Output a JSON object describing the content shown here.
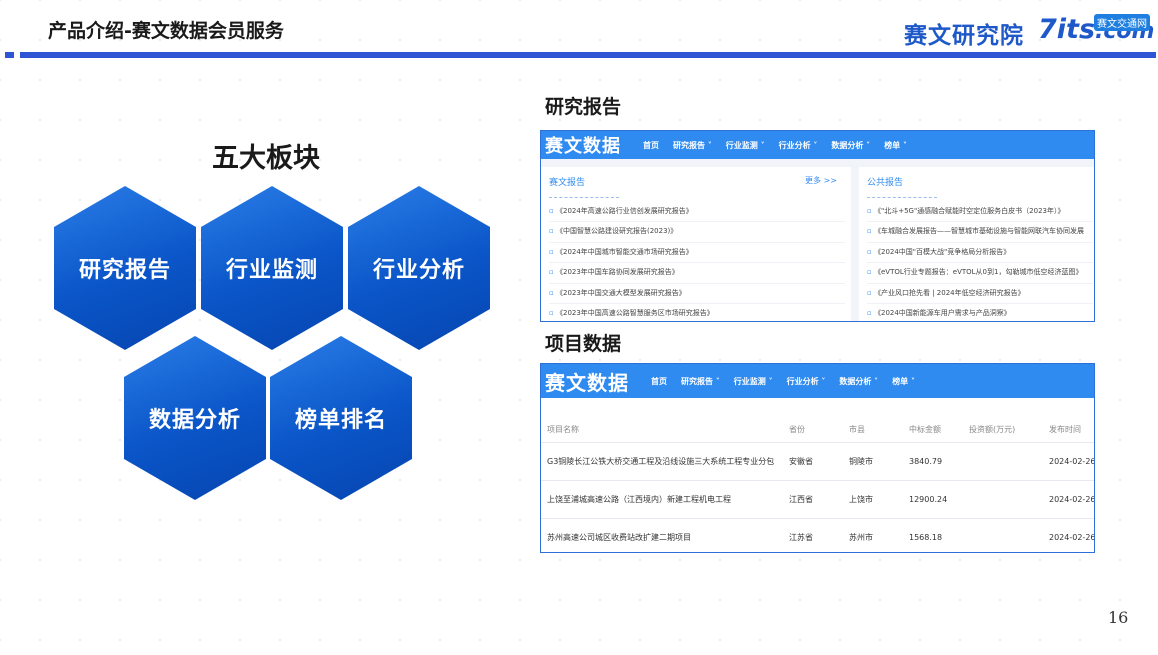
{
  "header": {
    "title": "产品介绍-赛文数据会员服务",
    "logo_text": "赛文研究院",
    "logo_7its": "7its",
    "logo_com": ".com",
    "logo_badge": "赛文交通网"
  },
  "colors": {
    "accent": "#2f54d4",
    "hex_blue": "#0a55c8",
    "nav_blue": "#2f8bf0"
  },
  "left": {
    "section_title": "五大板块",
    "modules": [
      "研究报告",
      "行业监测",
      "行业分析",
      "数据分析",
      "榜单排名"
    ]
  },
  "reports_panel": {
    "title": "研究报告",
    "nav": {
      "logo": "赛文数据",
      "items": [
        "首页",
        "研究报告 ˅",
        "行业监测 ˅",
        "行业分析 ˅",
        "数据分析 ˅",
        "榜单 ˅"
      ]
    },
    "col1": {
      "head": "赛文报告",
      "more": "更多 >>",
      "items": [
        "《2024年高速公路行业信创发展研究报告》",
        "《中国智慧公路建设研究报告(2023)》",
        "《2024年中国城市智能交通市场研究报告》",
        "《2023年中国车路协同发展研究报告》",
        "《2023年中国交通大模型发展研究报告》",
        "《2023年中国高速公路智慧服务区市场研究报告》"
      ]
    },
    "col2": {
      "head": "公共报告",
      "items": [
        "《\"北斗+5G\"通感融合赋能时空定位服务白皮书（2023年）》",
        "《车城融合发展报告——智慧城市基础设施与智能网联汽车协同发展",
        "《2024中国\"百模大战\"竞争格局分析报告》",
        "《eVTOL行业专题报告：eVTOL从0到1，勾勒城市低空经济蓝图》",
        "《产业风口抢先看 | 2024年低空经济研究报告》",
        "《2024中国新能源车用户需求与产品洞察》"
      ]
    }
  },
  "projects_panel": {
    "title": "项目数据",
    "nav": {
      "logo": "赛文数据",
      "items": [
        "首页",
        "研究报告 ˅",
        "行业监测 ˅",
        "行业分析 ˅",
        "数据分析 ˅",
        "榜单 ˅"
      ]
    },
    "columns": [
      "项目名称",
      "省份",
      "市县",
      "中标金额",
      "投资额(万元)",
      "发布时间"
    ],
    "rows": [
      [
        "G3铜陵长江公铁大桥交通工程及沿线设施三大系统工程专业分包",
        "安徽省",
        "铜陵市",
        "3840.79",
        "",
        "2024-02-26"
      ],
      [
        "上饶至浦城高速公路（江西境内）新建工程机电工程",
        "江西省",
        "上饶市",
        "12900.24",
        "",
        "2024-02-26"
      ],
      [
        "苏州高速公司城区收费站改扩建二期项目",
        "江苏省",
        "苏州市",
        "1568.18",
        "",
        "2024-02-26"
      ]
    ]
  },
  "page_number": "16"
}
